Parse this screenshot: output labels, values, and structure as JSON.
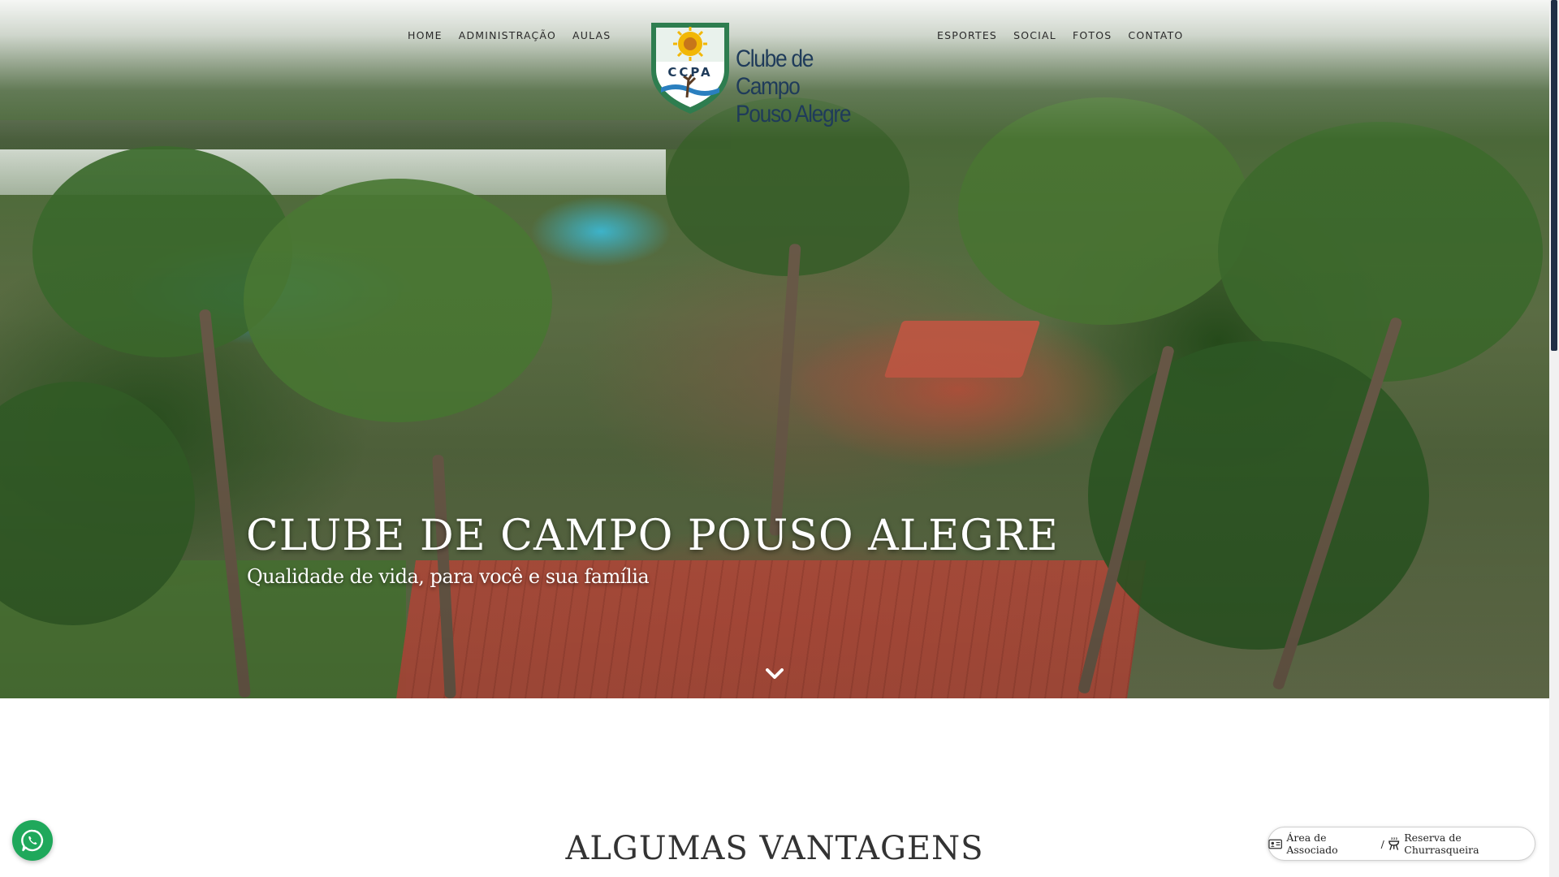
{
  "nav": {
    "left": [
      {
        "label": "HOME"
      },
      {
        "label": "ADMINISTRAÇÃO"
      },
      {
        "label": "AULAS"
      }
    ],
    "right": [
      {
        "label": "ESPORTES"
      },
      {
        "label": "SOCIAL"
      },
      {
        "label": "FOTOS"
      },
      {
        "label": "CONTATO"
      }
    ]
  },
  "logo": {
    "initials": "CCPA",
    "name_line1": "Clube de Campo",
    "name_line2": "Pouso Alegre"
  },
  "hero": {
    "title": "CLUBE DE CAMPO POUSO ALEGRE",
    "subtitle": "Qualidade de vida, para você e sua família",
    "scroll_icon": "chevron-down-icon"
  },
  "section": {
    "title": "ALGUMAS VANTAGENS"
  },
  "floating": {
    "whatsapp_icon": "whatsapp-icon",
    "member_area_label": "Área de Associado",
    "separator": "/",
    "bbq_label": "Reserva de Churrasqueira"
  },
  "colors": {
    "brand_navy": "#1f3b5a",
    "logo_green": "#2e7d4f",
    "whatsapp_green": "#1fa85b",
    "sun_yellow": "#f2b705"
  }
}
